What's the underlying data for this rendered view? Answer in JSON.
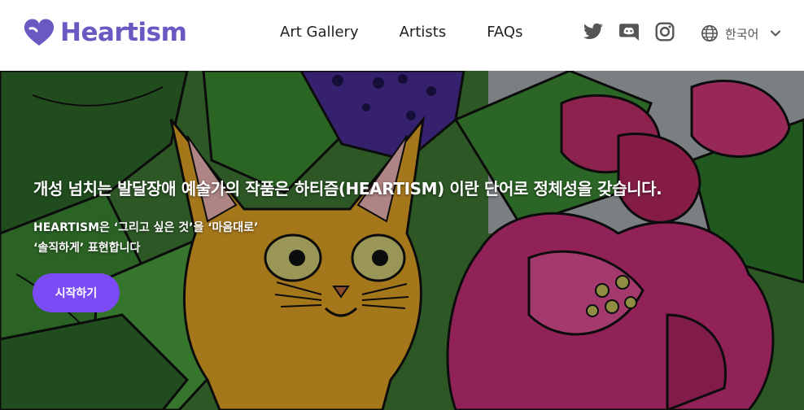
{
  "brand": {
    "name": "Heartism",
    "color": "#6b58c2",
    "icon": "heart-icon"
  },
  "nav": {
    "items": [
      {
        "label": "Art Gallery"
      },
      {
        "label": "Artists"
      },
      {
        "label": "FAQs"
      }
    ]
  },
  "socials": [
    {
      "icon": "twitter-icon"
    },
    {
      "icon": "discord-icon"
    },
    {
      "icon": "instagram-icon"
    }
  ],
  "language": {
    "icon": "globe-icon",
    "label": "한국어",
    "dropdown_icon": "chevron-down-icon"
  },
  "hero": {
    "title": "개성 넘치는 발달장애 예술가의 작품은 하티즘(HEARTISM) 이란 단어로 정체성을 갖습니다.",
    "subtitle_lines": [
      "HEARTISM은 ‘그리고 싶은 것’을 ‘마음대로’",
      "‘솔직하게’ 표현합니다"
    ],
    "cta_label": "시작하기",
    "cta_color": "#7b4cf5",
    "background_image": "illustrated cat among leaves and pink flowers"
  }
}
